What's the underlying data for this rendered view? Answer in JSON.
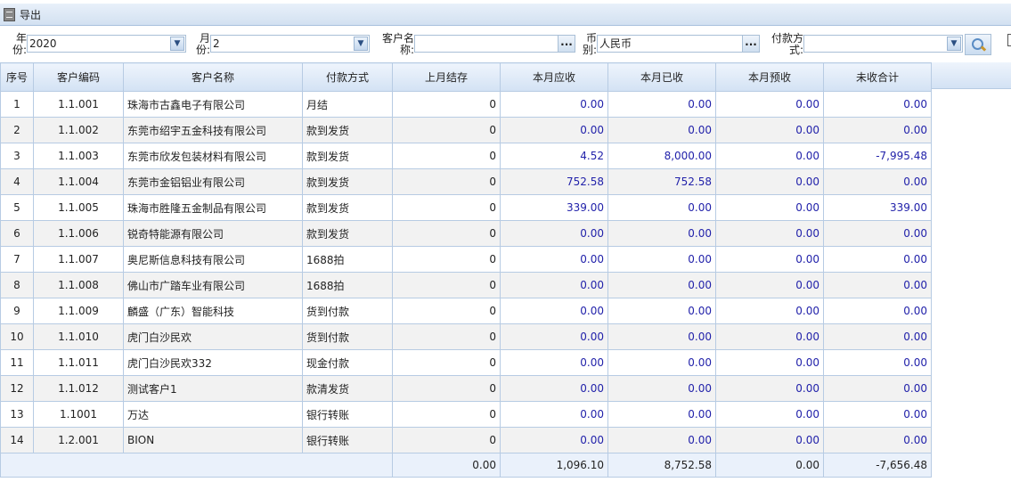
{
  "toolbar": {
    "export_label": "导出"
  },
  "filters": {
    "year": {
      "label": "年份:",
      "value": "2020"
    },
    "month": {
      "label": "月份:",
      "value": "2"
    },
    "customer": {
      "label": "客户名称:",
      "value": ""
    },
    "currency": {
      "label": "币别:",
      "value": "人民币"
    },
    "payment": {
      "label": "付款方式:",
      "value": ""
    },
    "more": "..."
  },
  "table": {
    "headers": [
      "序号",
      "客户编码",
      "客户名称",
      "付款方式",
      "上月结存",
      "本月应收",
      "本月已收",
      "本月预收",
      "未收合计"
    ],
    "rows": [
      [
        "1",
        "1.1.001",
        "珠海市古鑫电子有限公司",
        "月结",
        "0",
        "0.00",
        "0.00",
        "0.00",
        "0.00"
      ],
      [
        "2",
        "1.1.002",
        "东莞市绍宇五金科技有限公司",
        "款到发货",
        "0",
        "0.00",
        "0.00",
        "0.00",
        "0.00"
      ],
      [
        "3",
        "1.1.003",
        "东莞市欣发包装材料有限公司",
        "款到发货",
        "0",
        "4.52",
        "8,000.00",
        "0.00",
        "-7,995.48"
      ],
      [
        "4",
        "1.1.004",
        "东莞市金铝铝业有限公司",
        "款到发货",
        "0",
        "752.58",
        "752.58",
        "0.00",
        "0.00"
      ],
      [
        "5",
        "1.1.005",
        "珠海市胜隆五金制品有限公司",
        "款到发货",
        "0",
        "339.00",
        "0.00",
        "0.00",
        "339.00"
      ],
      [
        "6",
        "1.1.006",
        "锐奇特能源有限公司",
        "款到发货",
        "0",
        "0.00",
        "0.00",
        "0.00",
        "0.00"
      ],
      [
        "7",
        "1.1.007",
        "奥尼斯信息科技有限公司",
        "1688拍",
        "0",
        "0.00",
        "0.00",
        "0.00",
        "0.00"
      ],
      [
        "8",
        "1.1.008",
        "佛山市广踏车业有限公司",
        "1688拍",
        "0",
        "0.00",
        "0.00",
        "0.00",
        "0.00"
      ],
      [
        "9",
        "1.1.009",
        "麟盛（广东）智能科技",
        "货到付款",
        "0",
        "0.00",
        "0.00",
        "0.00",
        "0.00"
      ],
      [
        "10",
        "1.1.010",
        "虎门白沙民欢",
        "货到付款",
        "0",
        "0.00",
        "0.00",
        "0.00",
        "0.00"
      ],
      [
        "11",
        "1.1.011",
        "虎门白沙民欢332",
        "现金付款",
        "0",
        "0.00",
        "0.00",
        "0.00",
        "0.00"
      ],
      [
        "12",
        "1.1.012",
        "测试客户1",
        "款清发货",
        "0",
        "0.00",
        "0.00",
        "0.00",
        "0.00"
      ],
      [
        "13",
        "1.1001",
        "万达",
        "银行转账",
        "0",
        "0.00",
        "0.00",
        "0.00",
        "0.00"
      ],
      [
        "14",
        "1.2.001",
        "BION",
        "银行转账",
        "0",
        "0.00",
        "0.00",
        "0.00",
        "0.00"
      ]
    ],
    "totals": [
      "0.00",
      "1,096.10",
      "8,752.58",
      "0.00",
      "-7,656.48"
    ]
  }
}
